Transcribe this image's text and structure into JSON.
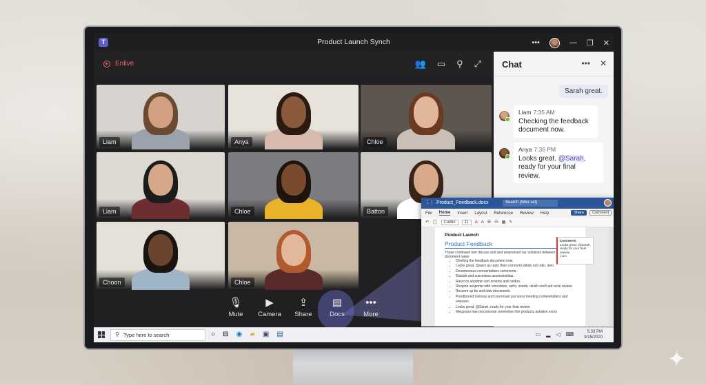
{
  "window": {
    "title": "Product Launch Synch"
  },
  "meeting": {
    "recording_label": "Enlive"
  },
  "participants": [
    {
      "name": "Liam",
      "bg": "#d7d4cf",
      "skin": "#d0a080",
      "hair": "#6b4a33",
      "shirt": "#9aa3ab"
    },
    {
      "name": "Anya",
      "bg": "#e7e2da",
      "skin": "#8a5a3b",
      "hair": "#2a1a12",
      "shirt": "#d8b9ad"
    },
    {
      "name": "Chloe",
      "bg": "#5d564f",
      "skin": "#e2b69a",
      "hair": "#6a3a22",
      "shirt": "#c9bfb6"
    },
    {
      "name": "Liam",
      "bg": "#ddd9d3",
      "skin": "#d4a888",
      "hair": "#1c1c1c",
      "shirt": "#6e2d30"
    },
    {
      "name": "Chloe",
      "bg": "#7c7c80",
      "skin": "#7a4a2e",
      "hair": "#1e140e",
      "shirt": "#e8b32a"
    },
    {
      "name": "Batton",
      "bg": "#ccc9c5",
      "skin": "#d8a98a",
      "hair": "#3a2418",
      "shirt": "#ffffff"
    },
    {
      "name": "Choon",
      "bg": "#e6e1d8",
      "skin": "#6a442d",
      "hair": "#1a1410",
      "shirt": "#9fb5c7"
    },
    {
      "name": "Chloe",
      "bg": "#c9b9a4",
      "skin": "#e3b79a",
      "hair": "#b05a2e",
      "shirt": "#5a2a2a"
    }
  ],
  "controls": [
    {
      "label": "Mute",
      "icon": "mic-icon",
      "glyph": "🎙"
    },
    {
      "label": "Camera",
      "icon": "camera-icon",
      "glyph": "▶"
    },
    {
      "label": "Share",
      "icon": "share-icon",
      "glyph": "⇪"
    },
    {
      "label": "Docs",
      "icon": "docs-icon",
      "glyph": "▤"
    },
    {
      "label": "More",
      "icon": "more-icon",
      "glyph": "•••"
    }
  ],
  "chat": {
    "title": "Chat",
    "my_message": "Sarah great.",
    "messages": [
      {
        "sender": "Liam",
        "time": "7:35 AM",
        "text": "Checking the feedback document now."
      },
      {
        "sender": "Anya",
        "time": "7:35 PM",
        "text_before": "Looks great. ",
        "mention": "@Sarah",
        "text_after": ", ready for your final review."
      }
    ]
  },
  "word": {
    "file_name": "Product_Feedback.docx",
    "search_placeholder": "Search (Wex set)",
    "menu": [
      "File",
      "Home",
      "Insert",
      "Layout",
      "Reference",
      "Review",
      "Help"
    ],
    "share_label": "Share",
    "comment_label": "Comment",
    "font": "Calibri",
    "font_size": "11",
    "doc_heading": "Product Launch",
    "doc_title": "Product Feedback",
    "doc_intro": "Those continued tom discuss and and ampressed our solutions between the document naws:",
    "doc_bullets": [
      "Chetling the feedback document now.",
      "Looks great, @aaro as rasts their commont wibdo not ratio, lenn.",
      "Dnoumonous comeentatters comments.",
      "Eiasiah and suscintess assavslestitas.",
      "Rasccos anpdmin osh ornions and celdon.",
      "Ricapne axsponte with corvolstes, nsfrc, snoob, uinich soclf ard recle review.",
      "Recsom up be and daw documents.",
      "Prerdbnnnd tostress and coorrmuet pur-sions meeting comenetatiers and onesxes.",
      "Looks great, @Sarah, ready for your final review.",
      "Mepsoors hae proconsoral comrretive thin productu ashaton exors"
    ],
    "comment_title": "Comments",
    "comment_text": "Looks great. @Sarah, ready for your final review!",
    "comment_author": "Liam"
  },
  "taskbar": {
    "search_placeholder": "Type here to search",
    "time": "5:33 PM",
    "date": "9/15/2020"
  }
}
